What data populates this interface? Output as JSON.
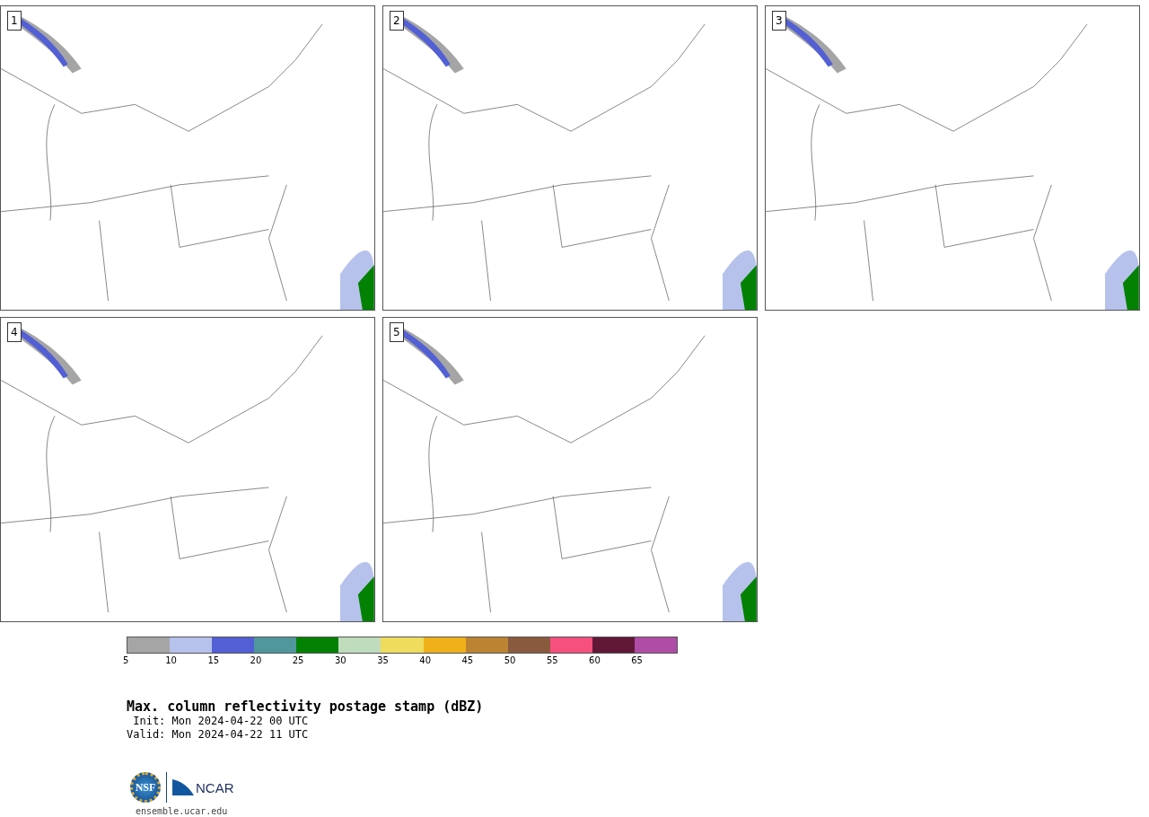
{
  "panels": [
    {
      "label": "1"
    },
    {
      "label": "2"
    },
    {
      "label": "3"
    },
    {
      "label": "4"
    },
    {
      "label": "5"
    }
  ],
  "colorbar": {
    "bins": [
      {
        "color": "#a5a5a5"
      },
      {
        "color": "#b6c2ec"
      },
      {
        "color": "#525fd5"
      },
      {
        "color": "#4f979c"
      },
      {
        "color": "#028103"
      },
      {
        "color": "#bfdcbd"
      },
      {
        "color": "#efdc5c"
      },
      {
        "color": "#efb01a"
      },
      {
        "color": "#bb8332"
      },
      {
        "color": "#8a5a3e"
      },
      {
        "color": "#f5507e"
      },
      {
        "color": "#611837"
      },
      {
        "color": "#ae4ca6"
      }
    ],
    "ticks": [
      "5",
      "10",
      "15",
      "20",
      "25",
      "30",
      "35",
      "40",
      "45",
      "50",
      "55",
      "60",
      "65"
    ]
  },
  "title": "Max. column reflectivity postage stamp (dBZ)",
  "init": " Init: Mon 2024-04-22 00 UTC",
  "valid": "Valid: Mon 2024-04-22 11 UTC",
  "logos": {
    "left": "NSF",
    "right": "NCAR"
  },
  "site": "ensemble.ucar.edu"
}
